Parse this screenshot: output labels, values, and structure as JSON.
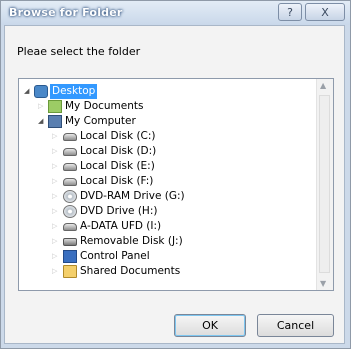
{
  "dialog": {
    "title": "Browse for Folder",
    "help_glyph": "?",
    "close_glyph": "X",
    "prompt": "Pleae select the folder",
    "ok_label": "OK",
    "cancel_label": "Cancel"
  },
  "tree": {
    "expand_open_glyph": "◢",
    "expand_closed_glyph": "▷",
    "items": [
      {
        "label": "Desktop",
        "icon": "desktop-icon",
        "selected": true
      },
      {
        "label": "My Documents",
        "icon": "documents-icon"
      },
      {
        "label": "My Computer",
        "icon": "computer-icon"
      },
      {
        "label": "Local Disk (C:)",
        "icon": "hard-disk-icon"
      },
      {
        "label": "Local Disk (D:)",
        "icon": "hard-disk-icon"
      },
      {
        "label": "Local Disk (E:)",
        "icon": "hard-disk-icon"
      },
      {
        "label": "Local Disk (F:)",
        "icon": "hard-disk-icon"
      },
      {
        "label": "DVD-RAM Drive (G:)",
        "icon": "dvd-drive-icon"
      },
      {
        "label": "DVD Drive (H:)",
        "icon": "dvd-drive-icon"
      },
      {
        "label": "A-DATA UFD (I:)",
        "icon": "usb-drive-icon"
      },
      {
        "label": "Removable Disk (J:)",
        "icon": "removable-disk-icon"
      },
      {
        "label": "Control Panel",
        "icon": "control-panel-icon"
      },
      {
        "label": "Shared Documents",
        "icon": "folder-icon"
      }
    ]
  },
  "scrollbar": {
    "up_glyph": "▲",
    "down_glyph": "▼"
  }
}
